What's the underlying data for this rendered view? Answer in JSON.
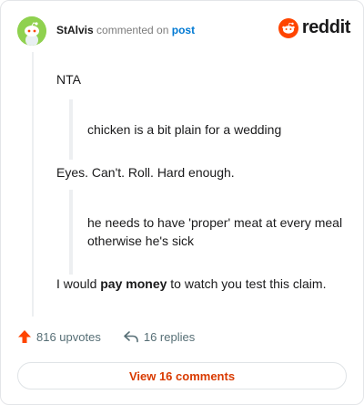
{
  "header": {
    "author": "StAlvis",
    "action_text": "commented on",
    "post_link": "post",
    "logo_text": "reddit"
  },
  "comment": {
    "p1": "NTA",
    "quote1": "chicken is a bit plain for a wedding",
    "p2": "Eyes. Can't. Roll. Hard enough.",
    "quote2": "he needs to have 'proper' meat at every meal otherwise he's sick",
    "p3_before": "I would ",
    "p3_bold": "pay money",
    "p3_after": " to watch you test this claim."
  },
  "actions": {
    "upvotes": "816 upvotes",
    "replies": "16 replies"
  },
  "footer": {
    "view_comments": "View 16 comments"
  },
  "colors": {
    "accent": "#d93a00",
    "reddit_orange": "#ff4500",
    "link_blue": "#0079d3"
  }
}
